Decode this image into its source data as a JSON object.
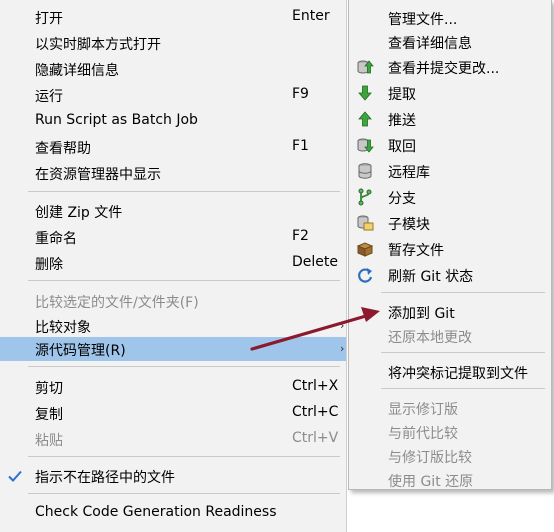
{
  "main_menu": {
    "items": [
      {
        "label": "打开",
        "accel": "Enter"
      },
      {
        "label": "以实时脚本方式打开",
        "accel": ""
      },
      {
        "label": "隐藏详细信息",
        "accel": ""
      },
      {
        "label": "运行",
        "accel": "F9"
      },
      {
        "label": "Run Script as Batch Job",
        "accel": ""
      },
      {
        "label": "查看帮助",
        "accel": "F1"
      },
      {
        "label": "在资源管理器中显示",
        "accel": ""
      },
      {
        "label": "创建 Zip 文件",
        "accel": ""
      },
      {
        "label": "重命名",
        "accel": "F2"
      },
      {
        "label": "删除",
        "accel": "Delete"
      },
      {
        "label": "比较选定的文件/文件夹(F)",
        "accel": ""
      },
      {
        "label": "比较对象",
        "accel": ""
      },
      {
        "label": "源代码管理(R)",
        "accel": ""
      },
      {
        "label": "剪切",
        "accel": "Ctrl+X"
      },
      {
        "label": "复制",
        "accel": "Ctrl+C"
      },
      {
        "label": "粘贴",
        "accel": "Ctrl+V"
      },
      {
        "label": "指示不在路径中的文件",
        "accel": ""
      },
      {
        "label": "Check Code Generation Readiness",
        "accel": ""
      }
    ],
    "submenu_arrow": "›",
    "indicator_checked": true
  },
  "source_control_submenu": {
    "items": [
      {
        "label": "管理文件...",
        "icon": "none"
      },
      {
        "label": "查看详细信息",
        "icon": "none"
      },
      {
        "label": "查看并提交更改...",
        "icon": "commit-icon"
      },
      {
        "label": "提取",
        "icon": "fetch-arrow-icon"
      },
      {
        "label": "推送",
        "icon": "push-arrow-icon"
      },
      {
        "label": "取回",
        "icon": "pull-icon"
      },
      {
        "label": "远程库",
        "icon": "remote-database-icon"
      },
      {
        "label": "分支",
        "icon": "branch-icon"
      },
      {
        "label": "子模块",
        "icon": "submodule-icon"
      },
      {
        "label": "暂存文件",
        "icon": "stash-box-icon"
      },
      {
        "label": "刷新 Git 状态",
        "icon": "refresh-icon"
      },
      {
        "label": "添加到 Git",
        "icon": "none"
      },
      {
        "label": "还原本地更改",
        "icon": "none"
      },
      {
        "label": "将冲突标记提取到文件",
        "icon": "none"
      },
      {
        "label": "显示修订版",
        "icon": "none"
      },
      {
        "label": "与前代比较",
        "icon": "none"
      },
      {
        "label": "与修订版比较",
        "icon": "none"
      },
      {
        "label": "使用 Git 还原",
        "icon": "none"
      }
    ]
  },
  "colors": {
    "menu_bg": "#f2f2f2",
    "selected_bg": "#9fc6ea",
    "disabled_text": "#8c8c8c",
    "annotation_arrow": "#8b1a2e",
    "check": "#2e6fd3"
  }
}
